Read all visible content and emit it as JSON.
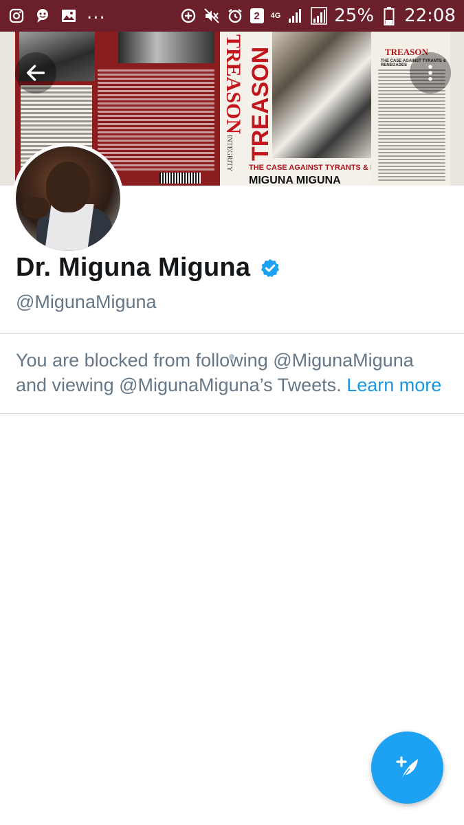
{
  "status_bar": {
    "left_icons": [
      "instagram-icon",
      "chat-bubble-icon",
      "image-icon"
    ],
    "more": "...",
    "sim_badge": "2",
    "network": "4G",
    "battery_percent": "25%",
    "time": "22:08",
    "background_color": "#6b1f2a"
  },
  "banner": {
    "spine_title": "TREASON",
    "spine_subtitle": "INTEGRITY",
    "front_subtitle": "THE CASE AGAINST TYRANTS & RENEGADES",
    "front_author": "MIGUNA MIGUNA",
    "back_title": "TREASON",
    "back_subtitle": "THE CASE AGAINST TYRANTS & RENEGADES"
  },
  "profile": {
    "display_name": "Dr. Miguna Miguna",
    "handle": "@MigunaMiguna",
    "verified": true
  },
  "blocked": {
    "message": "You are blocked from following @MigunaMiguna and viewing @MigunaMiguna’s Tweets.",
    "link_text": "Learn more"
  },
  "colors": {
    "accent": "#1da1f2",
    "link": "#1b95e0",
    "secondary_text": "#657786",
    "primary_text": "#14171a"
  },
  "fab": {
    "icon": "compose-tweet-icon"
  }
}
